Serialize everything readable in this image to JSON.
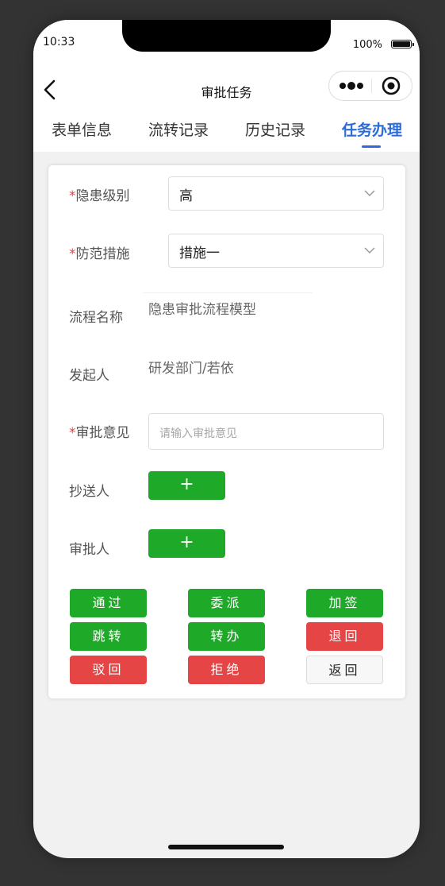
{
  "status_bar": {
    "time": "10:33",
    "battery": "100%"
  },
  "nav": {
    "title": "审批任务"
  },
  "tabs": [
    {
      "label": "表单信息",
      "active": false
    },
    {
      "label": "流转记录",
      "active": false
    },
    {
      "label": "历史记录",
      "active": false
    },
    {
      "label": "任务办理",
      "active": true
    }
  ],
  "form": {
    "hazard_level": {
      "required_mark": "*",
      "label": "隐患级别",
      "value": "高"
    },
    "measures": {
      "required_mark": "*",
      "label": "防范措施",
      "value": "措施一"
    },
    "process_name": {
      "label": "流程名称",
      "value": "隐患审批流程模型"
    },
    "initiator": {
      "label": "发起人",
      "value": "研发部门/若依"
    },
    "opinion": {
      "required_mark": "*",
      "label": "审批意见",
      "placeholder": "请输入审批意见"
    },
    "cc": {
      "label": "抄送人",
      "button": "+"
    },
    "approver": {
      "label": "审批人",
      "button": "+"
    }
  },
  "actions": {
    "pass": "通过",
    "delegate": "委派",
    "add_sign": "加签",
    "jump": "跳转",
    "transfer": "转办",
    "return_back": "退回",
    "reject": "驳回",
    "refuse": "拒绝",
    "go_back": "返回"
  },
  "colors": {
    "accent": "#2c6cd8",
    "success": "#1eaa28",
    "danger": "#e54545",
    "required": "#e84343"
  }
}
